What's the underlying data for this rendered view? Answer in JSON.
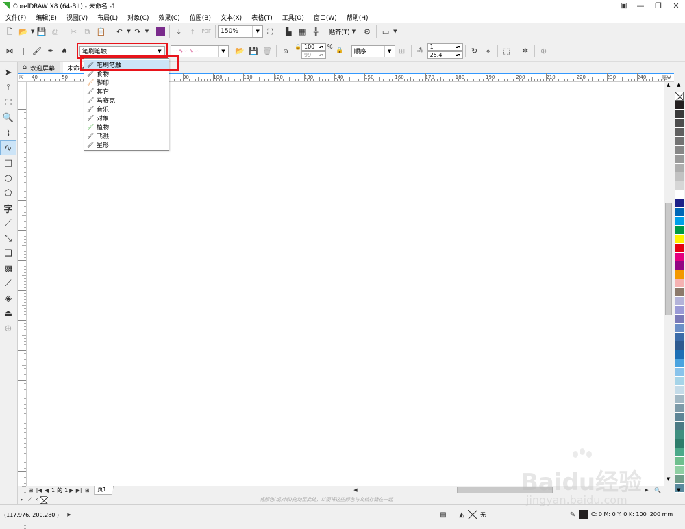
{
  "window": {
    "title": "CorelDRAW X8 (64-Bit) - 未命名 -1",
    "controls": [
      "▣",
      "—",
      "❐",
      "✕"
    ]
  },
  "menubar": {
    "items": [
      "文件(F)",
      "编辑(E)",
      "视图(V)",
      "布局(L)",
      "对象(C)",
      "效果(C)",
      "位图(B)",
      "文本(X)",
      "表格(T)",
      "工具(O)",
      "窗口(W)",
      "帮助(H)"
    ]
  },
  "standard_toolbar": {
    "zoom_value": "150%",
    "snap_label": "贴齐(T)"
  },
  "property_bar": {
    "preset_value": "笔刷笔触",
    "order_value": "顺序",
    "size_top": "100",
    "size_bottom": "99",
    "percent": "%",
    "spacing_count": "1",
    "spacing_value": "25.4"
  },
  "dropdown": {
    "items": [
      {
        "label": "笔刷笔触",
        "icon": "brush-icon"
      },
      {
        "label": "食物",
        "icon": "food-icon"
      },
      {
        "label": "脚印",
        "icon": "footprint-icon"
      },
      {
        "label": "其它",
        "icon": "other-icon"
      },
      {
        "label": "马赛克",
        "icon": "mosaic-icon"
      },
      {
        "label": "音乐",
        "icon": "music-icon"
      },
      {
        "label": "对象",
        "icon": "object-icon"
      },
      {
        "label": "植物",
        "icon": "plant-icon"
      },
      {
        "label": "飞溅",
        "icon": "splash-icon"
      },
      {
        "label": "星形",
        "icon": "star-icon"
      }
    ]
  },
  "tabs": {
    "welcome": "欢迎屏幕",
    "document": "未命名"
  },
  "ruler": {
    "unit": "毫米",
    "labels": [
      "40",
      "50",
      "60",
      "70",
      "80",
      "90",
      "100",
      "110",
      "120",
      "130",
      "140",
      "150",
      "160",
      "170",
      "180",
      "190",
      "200",
      "210",
      "220",
      "230",
      "240"
    ]
  },
  "page_nav": {
    "current": "1",
    "of_label": "的",
    "total": "1",
    "page_tab": "页1"
  },
  "color_hint": "将颜色(或对象)拖动至此处，以便将这些颜色与文档存储在一起",
  "status": {
    "coords": "(117.976, 200.280 )",
    "fill_none": "无",
    "outline_info": "C: 0 M: 0 Y: 0 K: 100  .200 mm"
  },
  "palette": {
    "colors": [
      "#231f20",
      "#3a3a3a",
      "#4d4d4d",
      "#606060",
      "#737373",
      "#878787",
      "#9a9a9a",
      "#aeaeae",
      "#c2c2c2",
      "#d6d6d6",
      "#ffffff",
      "#1d2088",
      "#0068b7",
      "#00a0e9",
      "#009944",
      "#fff100",
      "#e60012",
      "#e4007f",
      "#920783",
      "#f39800",
      "#f5b2b2",
      "#8c7a6b",
      "#b3b3d9",
      "#9a9ad6",
      "#7a7ab8",
      "#6b8fc7",
      "#3b6ba8",
      "#2e5a8f",
      "#1c6fb5",
      "#4aa3df",
      "#89c3eb",
      "#a6d4e8",
      "#c4dbe8",
      "#a2b8c4",
      "#7d9aa8",
      "#5e8596",
      "#4b7a84",
      "#3f8f7f",
      "#2e7d6b",
      "#4ca98a",
      "#6fbf8e",
      "#8fcfa3",
      "#6f9e8a",
      "#5a8a9e"
    ]
  },
  "watermark": {
    "brand": "Baidu经验",
    "url": "jingyan.baidu.com"
  },
  "colors": {
    "highlight_red": "#e8141b",
    "selection_blue": "#cce4f7",
    "accent_green": "#3aa935"
  }
}
